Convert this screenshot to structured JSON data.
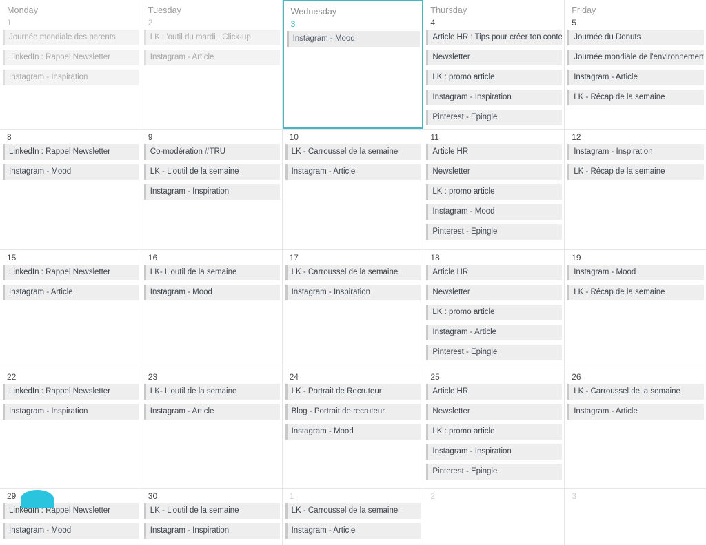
{
  "accent_color": "#45b6c4",
  "marker_color": "#2bc4de",
  "chip_bg": "#eeeeee",
  "weekdays": [
    "Monday",
    "Tuesday",
    "Wednesday",
    "Thursday",
    "Friday"
  ],
  "weeks": [
    {
      "days": [
        {
          "number": "1",
          "faded": true,
          "other_month": false,
          "selected": false,
          "events": [
            "Journée mondiale des parents",
            "LinkedIn : Rappel Newsletter",
            "Instagram - Inspiration"
          ]
        },
        {
          "number": "2",
          "faded": true,
          "other_month": false,
          "selected": false,
          "events": [
            "LK L'outil du mardi : Click-up",
            "Instagram - Article"
          ]
        },
        {
          "number": "3",
          "faded": false,
          "other_month": false,
          "selected": true,
          "events": [
            "Instagram - Mood"
          ]
        },
        {
          "number": "4",
          "faded": false,
          "other_month": false,
          "selected": false,
          "events": [
            "Article HR : Tips pour créer ton contenu",
            "Newsletter",
            "LK : promo article",
            "Instagram - Inspiration",
            "Pinterest - Epingle"
          ]
        },
        {
          "number": "5",
          "faded": false,
          "other_month": false,
          "selected": false,
          "events": [
            "Journée du Donuts",
            "Journée mondiale de l'environnement",
            "Instagram - Article",
            "LK - Récap de la semaine"
          ]
        }
      ]
    },
    {
      "days": [
        {
          "number": "8",
          "faded": false,
          "other_month": false,
          "selected": false,
          "events": [
            "LinkedIn : Rappel Newsletter",
            "Instagram - Mood"
          ]
        },
        {
          "number": "9",
          "faded": false,
          "other_month": false,
          "selected": false,
          "events": [
            "Co-modération #TRU",
            "LK - L'outil de la semaine",
            "Instagram - Inspiration"
          ]
        },
        {
          "number": "10",
          "faded": false,
          "other_month": false,
          "selected": false,
          "events": [
            "LK - Carroussel de la semaine",
            "Instagram - Article"
          ]
        },
        {
          "number": "11",
          "faded": false,
          "other_month": false,
          "selected": false,
          "events": [
            "Article HR",
            "Newsletter",
            "LK : promo article",
            "Instagram - Mood",
            "Pinterest - Epingle"
          ]
        },
        {
          "number": "12",
          "faded": false,
          "other_month": false,
          "selected": false,
          "events": [
            "Instagram - Inspiration",
            "LK - Récap de la semaine"
          ]
        }
      ]
    },
    {
      "days": [
        {
          "number": "15",
          "faded": false,
          "other_month": false,
          "selected": false,
          "events": [
            "LinkedIn : Rappel Newsletter",
            "Instagram - Article"
          ]
        },
        {
          "number": "16",
          "faded": false,
          "other_month": false,
          "selected": false,
          "events": [
            "LK- L'outil de la semaine",
            "Instagram - Mood"
          ]
        },
        {
          "number": "17",
          "faded": false,
          "other_month": false,
          "selected": false,
          "events": [
            "LK - Carroussel de la semaine",
            "Instagram - Inspiration"
          ]
        },
        {
          "number": "18",
          "faded": false,
          "other_month": false,
          "selected": false,
          "events": [
            "Article HR",
            "Newsletter",
            "LK : promo article",
            "Instagram - Article",
            "Pinterest - Epingle"
          ]
        },
        {
          "number": "19",
          "faded": false,
          "other_month": false,
          "selected": false,
          "events": [
            "Instagram - Mood",
            "LK - Récap de la semaine"
          ]
        }
      ]
    },
    {
      "days": [
        {
          "number": "22",
          "faded": false,
          "other_month": false,
          "selected": false,
          "events": [
            "LinkedIn : Rappel Newsletter",
            "Instagram - Inspiration"
          ]
        },
        {
          "number": "23",
          "faded": false,
          "other_month": false,
          "selected": false,
          "events": [
            "LK- L'outil de la semaine",
            "Instagram - Article"
          ]
        },
        {
          "number": "24",
          "faded": false,
          "other_month": false,
          "selected": false,
          "events": [
            "LK - Portrait de Recruteur",
            "Blog - Portrait de recruteur",
            "Instagram - Mood"
          ]
        },
        {
          "number": "25",
          "faded": false,
          "other_month": false,
          "selected": false,
          "events": [
            "Article HR",
            "Newsletter",
            "LK : promo article",
            "Instagram - Inspiration",
            "Pinterest - Epingle"
          ]
        },
        {
          "number": "26",
          "faded": false,
          "other_month": false,
          "selected": false,
          "events": [
            "LK - Carroussel de la semaine",
            "Instagram - Article"
          ]
        }
      ]
    },
    {
      "days": [
        {
          "number": "29",
          "faded": false,
          "other_month": false,
          "selected": false,
          "events": [
            "LinkedIn : Rappel Newsletter",
            "Instagram - Mood"
          ]
        },
        {
          "number": "30",
          "faded": false,
          "other_month": false,
          "selected": false,
          "events": [
            "LK - L'outil de la semaine",
            "Instagram - Inspiration"
          ]
        },
        {
          "number": "1",
          "faded": false,
          "other_month": true,
          "selected": false,
          "events": [
            "LK - Carroussel de la semaine",
            "Instagram - Article"
          ]
        },
        {
          "number": "2",
          "faded": false,
          "other_month": true,
          "selected": false,
          "events": []
        },
        {
          "number": "3",
          "faded": false,
          "other_month": true,
          "selected": false,
          "events": []
        }
      ]
    }
  ]
}
